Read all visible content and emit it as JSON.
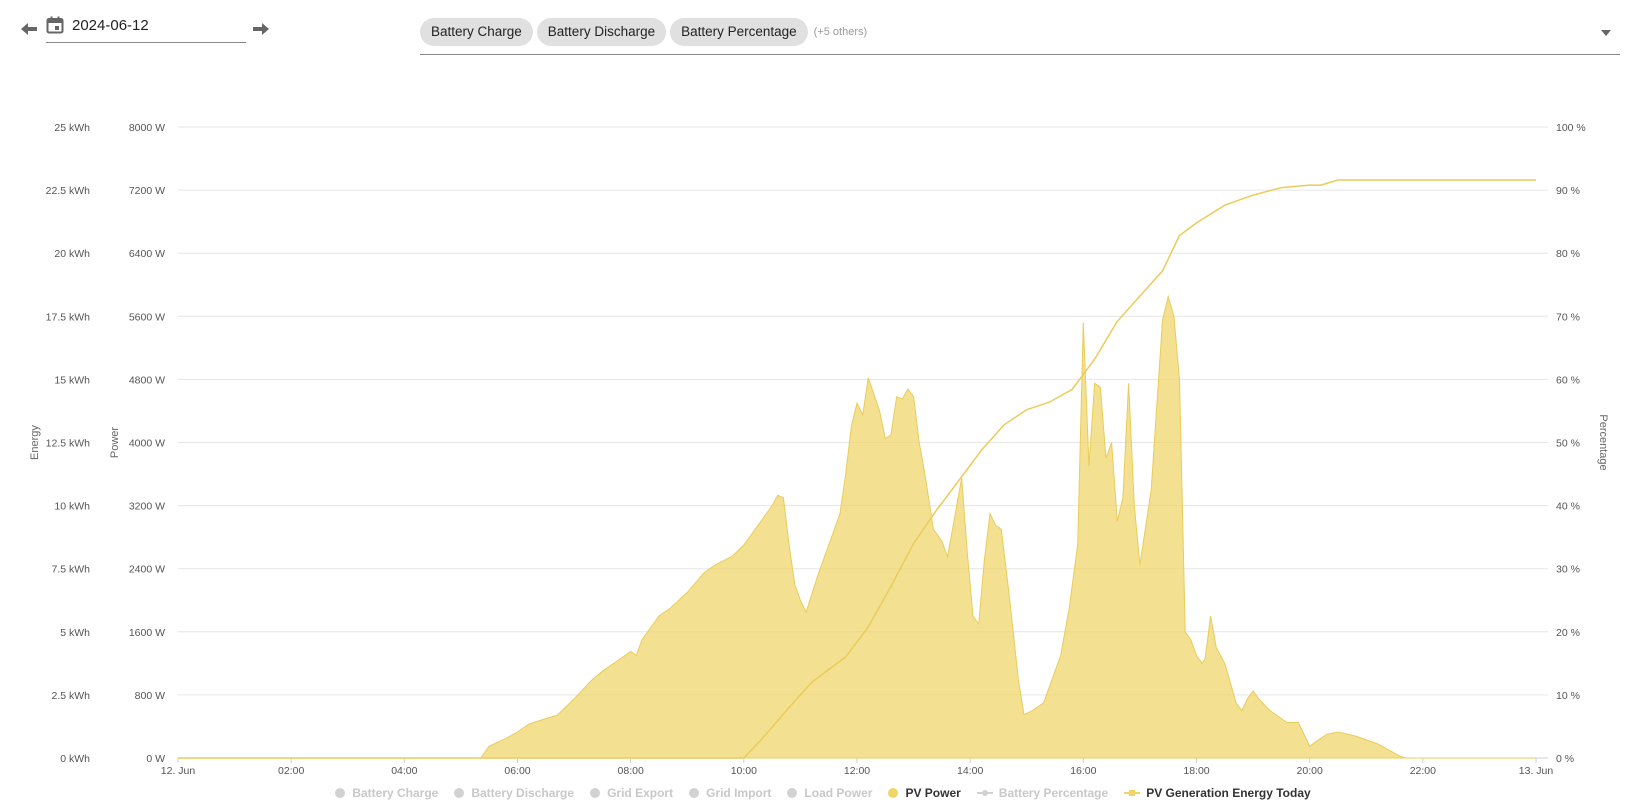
{
  "toolbar": {
    "date": "2024-06-12",
    "chips": [
      "Battery Charge",
      "Battery Discharge",
      "Battery Percentage"
    ],
    "others": "(+5 others)"
  },
  "legend": [
    {
      "label": "Battery Charge",
      "active": false,
      "marker": "circle"
    },
    {
      "label": "Battery Discharge",
      "active": false,
      "marker": "circle"
    },
    {
      "label": "Grid Export",
      "active": false,
      "marker": "circle"
    },
    {
      "label": "Grid Import",
      "active": false,
      "marker": "circle"
    },
    {
      "label": "Load Power",
      "active": false,
      "marker": "circle"
    },
    {
      "label": "PV Power",
      "active": true,
      "marker": "circle"
    },
    {
      "label": "Battery Percentage",
      "active": false,
      "marker": "line-circle"
    },
    {
      "label": "PV Generation Energy Today",
      "active": true,
      "marker": "line-square"
    }
  ],
  "colors": {
    "pv": "#f0d467",
    "pv_line": "#e9cc5a",
    "grid": "#e6e6e6",
    "inactive": "#d2d2d2"
  },
  "chart_data": {
    "type": "area",
    "x_axis": {
      "ticks": [
        "12. Jun",
        "02:00",
        "04:00",
        "06:00",
        "08:00",
        "10:00",
        "12:00",
        "14:00",
        "16:00",
        "18:00",
        "20:00",
        "22:00",
        "13. Jun"
      ],
      "range_hours": [
        0,
        24
      ]
    },
    "axes": {
      "energy": {
        "title": "Energy",
        "ticks": [
          "0 kWh",
          "2.5 kWh",
          "5 kWh",
          "7.5 kWh",
          "10 kWh",
          "12.5 kWh",
          "15 kWh",
          "17.5 kWh",
          "20 kWh",
          "22.5 kWh",
          "25 kWh"
        ],
        "range": [
          0,
          25
        ]
      },
      "power": {
        "title": "Power",
        "ticks": [
          "0 W",
          "800 W",
          "1600 W",
          "2400 W",
          "3200 W",
          "4000 W",
          "4800 W",
          "5600 W",
          "6400 W",
          "7200 W",
          "8000 W"
        ],
        "range": [
          0,
          8000
        ]
      },
      "percentage": {
        "title": "Percentage",
        "ticks": [
          "0 %",
          "10 %",
          "20 %",
          "30 %",
          "40 %",
          "50 %",
          "60 %",
          "70 %",
          "80 %",
          "90 %",
          "100 %"
        ],
        "range": [
          0,
          100
        ]
      }
    },
    "grid": true,
    "series": [
      {
        "name": "PV Power",
        "type": "area",
        "axis": "power",
        "points": [
          [
            0,
            0
          ],
          [
            5.35,
            0
          ],
          [
            5.5,
            150
          ],
          [
            5.8,
            250
          ],
          [
            6.0,
            330
          ],
          [
            6.2,
            430
          ],
          [
            6.5,
            500
          ],
          [
            6.7,
            540
          ],
          [
            7.0,
            750
          ],
          [
            7.3,
            980
          ],
          [
            7.5,
            1100
          ],
          [
            7.8,
            1250
          ],
          [
            8.0,
            1350
          ],
          [
            8.1,
            1300
          ],
          [
            8.2,
            1500
          ],
          [
            8.5,
            1800
          ],
          [
            8.7,
            1900
          ],
          [
            9.0,
            2100
          ],
          [
            9.3,
            2350
          ],
          [
            9.5,
            2450
          ],
          [
            9.8,
            2560
          ],
          [
            10.0,
            2700
          ],
          [
            10.3,
            3000
          ],
          [
            10.5,
            3200
          ],
          [
            10.6,
            3330
          ],
          [
            10.7,
            3300
          ],
          [
            10.8,
            2700
          ],
          [
            10.9,
            2200
          ],
          [
            11.0,
            2000
          ],
          [
            11.1,
            1850
          ],
          [
            11.3,
            2300
          ],
          [
            11.5,
            2700
          ],
          [
            11.7,
            3100
          ],
          [
            11.8,
            3600
          ],
          [
            11.9,
            4200
          ],
          [
            12.0,
            4500
          ],
          [
            12.1,
            4350
          ],
          [
            12.2,
            4820
          ],
          [
            12.4,
            4400
          ],
          [
            12.5,
            4050
          ],
          [
            12.6,
            4100
          ],
          [
            12.7,
            4580
          ],
          [
            12.8,
            4550
          ],
          [
            12.9,
            4680
          ],
          [
            13.0,
            4580
          ],
          [
            13.1,
            4000
          ],
          [
            13.2,
            3600
          ],
          [
            13.35,
            2900
          ],
          [
            13.5,
            2750
          ],
          [
            13.6,
            2550
          ],
          [
            13.7,
            2950
          ],
          [
            13.85,
            3550
          ],
          [
            13.95,
            2600
          ],
          [
            14.05,
            1800
          ],
          [
            14.15,
            1700
          ],
          [
            14.25,
            2500
          ],
          [
            14.35,
            3100
          ],
          [
            14.45,
            2950
          ],
          [
            14.55,
            2900
          ],
          [
            14.7,
            2000
          ],
          [
            14.85,
            1000
          ],
          [
            14.95,
            550
          ],
          [
            15.1,
            600
          ],
          [
            15.3,
            700
          ],
          [
            15.5,
            1100
          ],
          [
            15.6,
            1300
          ],
          [
            15.75,
            1900
          ],
          [
            15.9,
            2700
          ],
          [
            16.0,
            5520
          ],
          [
            16.1,
            3700
          ],
          [
            16.2,
            4750
          ],
          [
            16.3,
            4700
          ],
          [
            16.4,
            3800
          ],
          [
            16.5,
            4000
          ],
          [
            16.6,
            3000
          ],
          [
            16.7,
            3300
          ],
          [
            16.8,
            4750
          ],
          [
            16.9,
            3200
          ],
          [
            17.0,
            2450
          ],
          [
            17.2,
            3400
          ],
          [
            17.4,
            5550
          ],
          [
            17.5,
            5850
          ],
          [
            17.6,
            5600
          ],
          [
            17.7,
            4800
          ],
          [
            17.8,
            1600
          ],
          [
            17.9,
            1500
          ],
          [
            18.0,
            1300
          ],
          [
            18.1,
            1200
          ],
          [
            18.15,
            1250
          ],
          [
            18.25,
            1800
          ],
          [
            18.35,
            1400
          ],
          [
            18.5,
            1200
          ],
          [
            18.7,
            700
          ],
          [
            18.8,
            600
          ],
          [
            18.9,
            750
          ],
          [
            19.0,
            850
          ],
          [
            19.1,
            750
          ],
          [
            19.3,
            600
          ],
          [
            19.5,
            500
          ],
          [
            19.6,
            450
          ],
          [
            19.8,
            450
          ],
          [
            20.0,
            150
          ],
          [
            20.1,
            200
          ],
          [
            20.3,
            300
          ],
          [
            20.5,
            330
          ],
          [
            20.8,
            280
          ],
          [
            21.0,
            230
          ],
          [
            21.2,
            180
          ],
          [
            21.4,
            100
          ],
          [
            21.6,
            20
          ],
          [
            21.7,
            0
          ],
          [
            24,
            0
          ]
        ]
      },
      {
        "name": "PV Generation Energy Today",
        "type": "line",
        "axis": "energy",
        "points": [
          [
            0,
            0
          ],
          [
            10.0,
            0
          ],
          [
            10.3,
            0.7
          ],
          [
            10.8,
            2.0
          ],
          [
            11.2,
            3.0
          ],
          [
            11.8,
            4.0
          ],
          [
            12.2,
            5.2
          ],
          [
            12.6,
            6.8
          ],
          [
            13.0,
            8.5
          ],
          [
            13.4,
            9.8
          ],
          [
            13.8,
            11.0
          ],
          [
            14.2,
            12.2
          ],
          [
            14.6,
            13.2
          ],
          [
            15.0,
            13.8
          ],
          [
            15.4,
            14.1
          ],
          [
            15.8,
            14.6
          ],
          [
            16.2,
            15.8
          ],
          [
            16.6,
            17.3
          ],
          [
            17.0,
            18.3
          ],
          [
            17.4,
            19.3
          ],
          [
            17.7,
            20.7
          ],
          [
            18.0,
            21.2
          ],
          [
            18.5,
            21.9
          ],
          [
            19.0,
            22.3
          ],
          [
            19.5,
            22.6
          ],
          [
            20.0,
            22.7
          ],
          [
            20.2,
            22.7
          ],
          [
            20.5,
            22.9
          ],
          [
            24,
            22.9
          ]
        ]
      }
    ]
  }
}
